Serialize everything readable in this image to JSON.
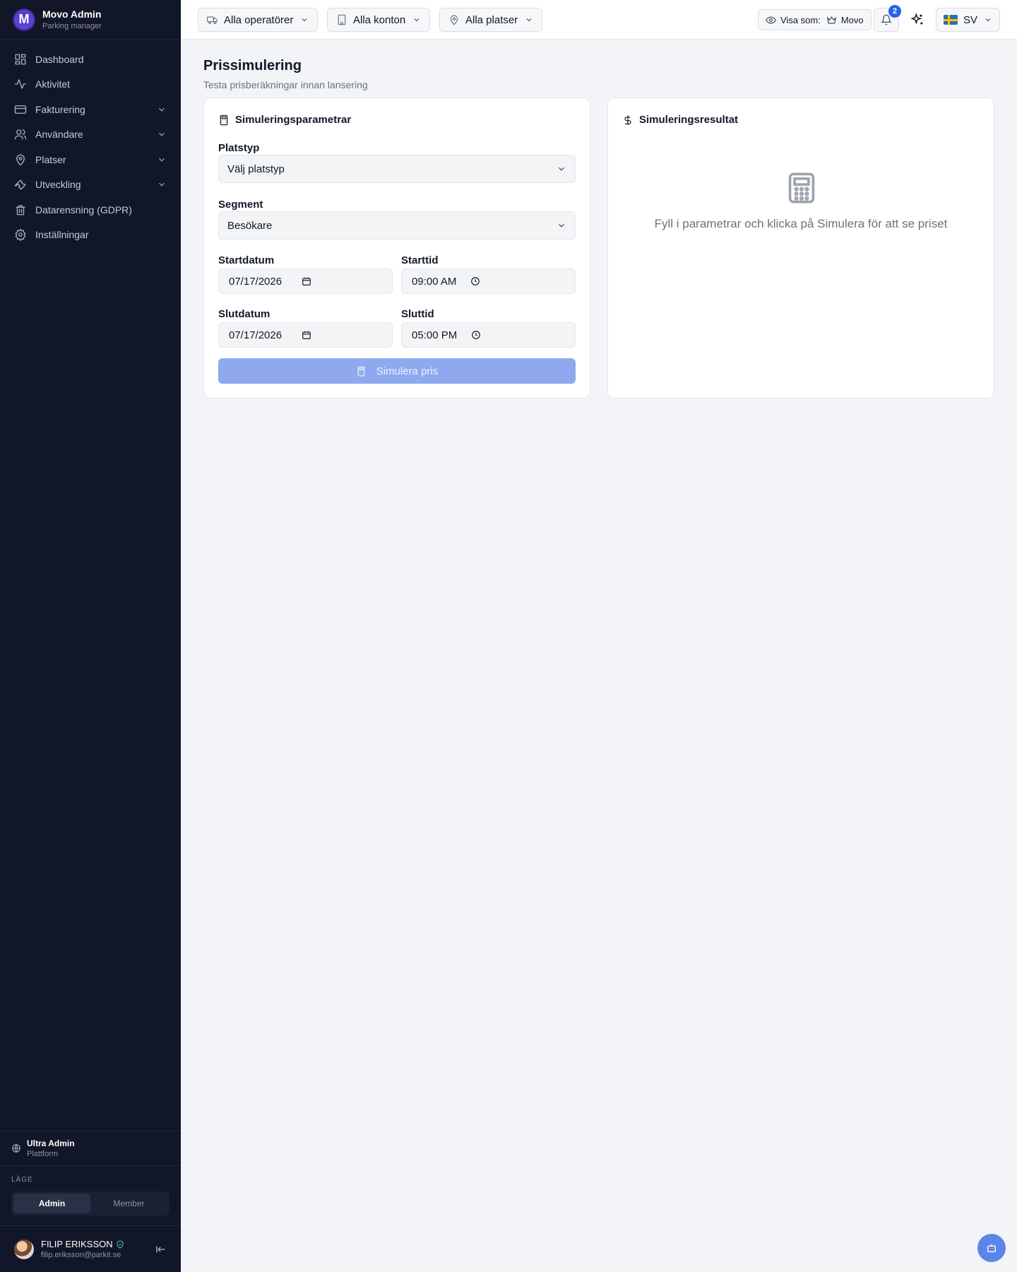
{
  "brand": {
    "name": "Movo Admin",
    "subtitle": "Parking manager",
    "logo_letter": "M"
  },
  "nav": [
    {
      "label": "Dashboard",
      "icon": "dashboard-icon",
      "expandable": false
    },
    {
      "label": "Aktivitet",
      "icon": "activity-icon",
      "expandable": false
    },
    {
      "label": "Fakturering",
      "icon": "credit-card-icon",
      "expandable": true
    },
    {
      "label": "Användare",
      "icon": "users-icon",
      "expandable": true
    },
    {
      "label": "Platser",
      "icon": "map-pin-icon",
      "expandable": true
    },
    {
      "label": "Utveckling",
      "icon": "wrench-icon",
      "expandable": true
    },
    {
      "label": "Datarensning (GDPR)",
      "icon": "trash-icon",
      "expandable": false
    },
    {
      "label": "Inställningar",
      "icon": "gear-icon",
      "expandable": false
    }
  ],
  "org": {
    "name": "Ultra Admin",
    "type": "Plattform"
  },
  "mode": {
    "label": "LÄGE",
    "options": [
      "Admin",
      "Member"
    ],
    "active": "Admin"
  },
  "user": {
    "name": "FILIP ERIKSSON",
    "email": "filip.eriksson@parkit.se"
  },
  "topbar": {
    "operators": "Alla operatörer",
    "accounts": "Alla konton",
    "places": "Alla platser",
    "view_as_label": "Visa som:",
    "view_as_value": "Movo",
    "notifications_count": "2",
    "language": "SV"
  },
  "page": {
    "title": "Prissimulering",
    "subtitle": "Testa prisberäkningar innan lansering"
  },
  "params": {
    "title": "Simuleringsparametrar",
    "place_type_label": "Platstyp",
    "place_type_value": "Välj platstyp",
    "segment_label": "Segment",
    "segment_value": "Besökare",
    "start_date_label": "Startdatum",
    "start_date_value": "07/17/2026",
    "start_time_label": "Starttid",
    "start_time_value": "09:00 AM",
    "end_date_label": "Slutdatum",
    "end_date_value": "07/17/2026",
    "end_time_label": "Sluttid",
    "end_time_value": "05:00 PM",
    "simulate_button": "Simulera pris"
  },
  "result": {
    "title": "Simuleringsresultat",
    "empty_text": "Fyll i parametrar och klicka på Simulera för att se priset"
  },
  "colors": {
    "sidebar_bg": "#111628",
    "accent": "#2563eb",
    "button_disabled": "#8fa9ef",
    "page_bg": "#f2f4f7"
  }
}
